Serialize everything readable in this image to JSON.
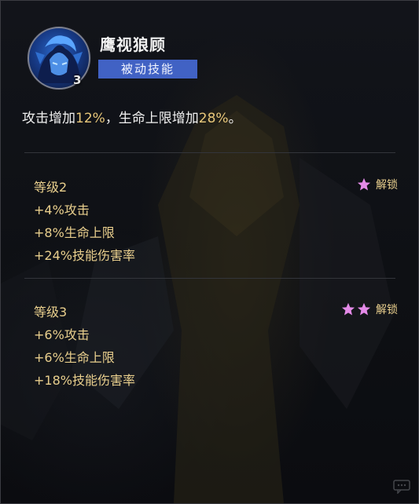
{
  "skill": {
    "name": "鹰视狼顾",
    "type": "被动技能",
    "level": "3",
    "icon": "warrior-portrait-icon",
    "summary_parts": [
      "攻击增加",
      "12%",
      "，生命上限增加",
      "28%",
      "。"
    ]
  },
  "levels": [
    {
      "title": "等级2",
      "stars": 1,
      "unlock_label": "解锁",
      "bonuses": [
        "+4%攻击",
        "+8%生命上限",
        "+24%技能伤害率"
      ]
    },
    {
      "title": "等级3",
      "stars": 2,
      "unlock_label": "解锁",
      "bonuses": [
        "+6%攻击",
        "+6%生命上限",
        "+18%技能伤害率"
      ]
    }
  ],
  "colors": {
    "accent_gold": "#e9cf8d",
    "highlight": "#e8c77a",
    "badge_blue": "#4162c4",
    "star_pink": "#e48ae8"
  }
}
